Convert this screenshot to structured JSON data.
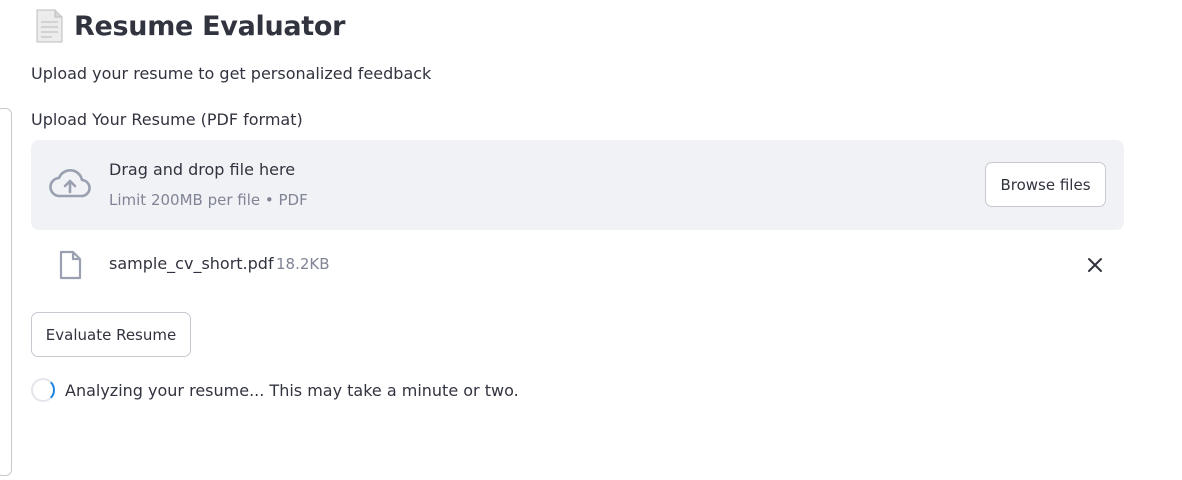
{
  "app": {
    "title": "Resume Evaluator",
    "subtitle": "Upload your resume to get personalized feedback"
  },
  "uploader": {
    "label": "Upload Your Resume (PDF format)",
    "drop_title": "Drag and drop file here",
    "drop_limit": "Limit 200MB per file • PDF",
    "browse_label": "Browse files",
    "icon": "cloud-upload-icon"
  },
  "uploaded_file": {
    "name": "sample_cv_short.pdf",
    "size": "18.2KB",
    "icon": "file-icon",
    "remove_icon": "close-icon"
  },
  "actions": {
    "evaluate_label": "Evaluate Resume"
  },
  "status": {
    "text": "Analyzing your resume... This may take a minute or two."
  },
  "colors": {
    "text": "#31333f",
    "muted": "#808495",
    "dropzone_bg": "#f0f2f6",
    "border": "#c7c9d0",
    "spinner_accent": "#1c83e1"
  }
}
